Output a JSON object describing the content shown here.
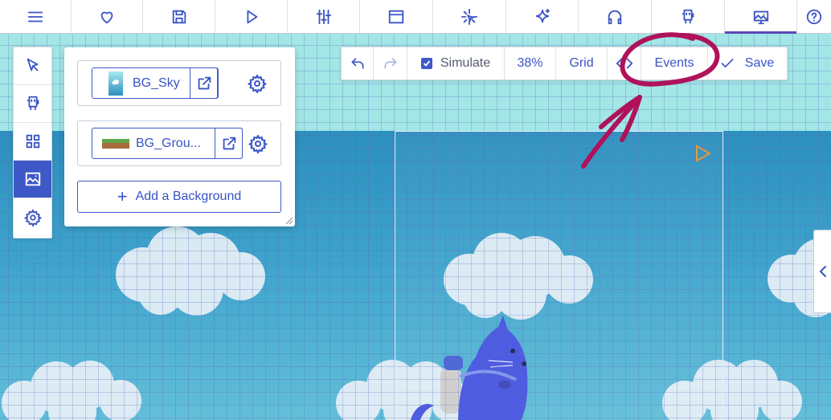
{
  "topnav": {
    "tabs": [
      {
        "name": "menu-icon"
      },
      {
        "name": "heart-icon"
      },
      {
        "name": "save-icon"
      },
      {
        "name": "play-icon"
      },
      {
        "name": "sliders-icon"
      },
      {
        "name": "window-icon"
      },
      {
        "name": "effects-icon"
      },
      {
        "name": "sparkle-icon"
      },
      {
        "name": "headphones-icon"
      },
      {
        "name": "robot-icon"
      },
      {
        "name": "image-icon",
        "active": true
      },
      {
        "name": "help-icon"
      }
    ],
    "accent": "#3a54c6"
  },
  "left_tools": [
    {
      "name": "select-arrow-icon"
    },
    {
      "name": "robot-icon"
    },
    {
      "name": "grid-icon"
    },
    {
      "name": "image-icon",
      "active": true
    },
    {
      "name": "gear-icon"
    }
  ],
  "backgrounds_panel": {
    "items": [
      {
        "label": "BG_Sky"
      },
      {
        "label": "BG_Grou..."
      }
    ],
    "add_label": "Add a Background"
  },
  "room_toolbar": {
    "simulate_label": "Simulate",
    "simulate_checked": true,
    "zoom": "38%",
    "grid_label": "Grid",
    "events_label": "Events",
    "save_label": "Save"
  },
  "annotation": {
    "color": "#b0125a"
  }
}
